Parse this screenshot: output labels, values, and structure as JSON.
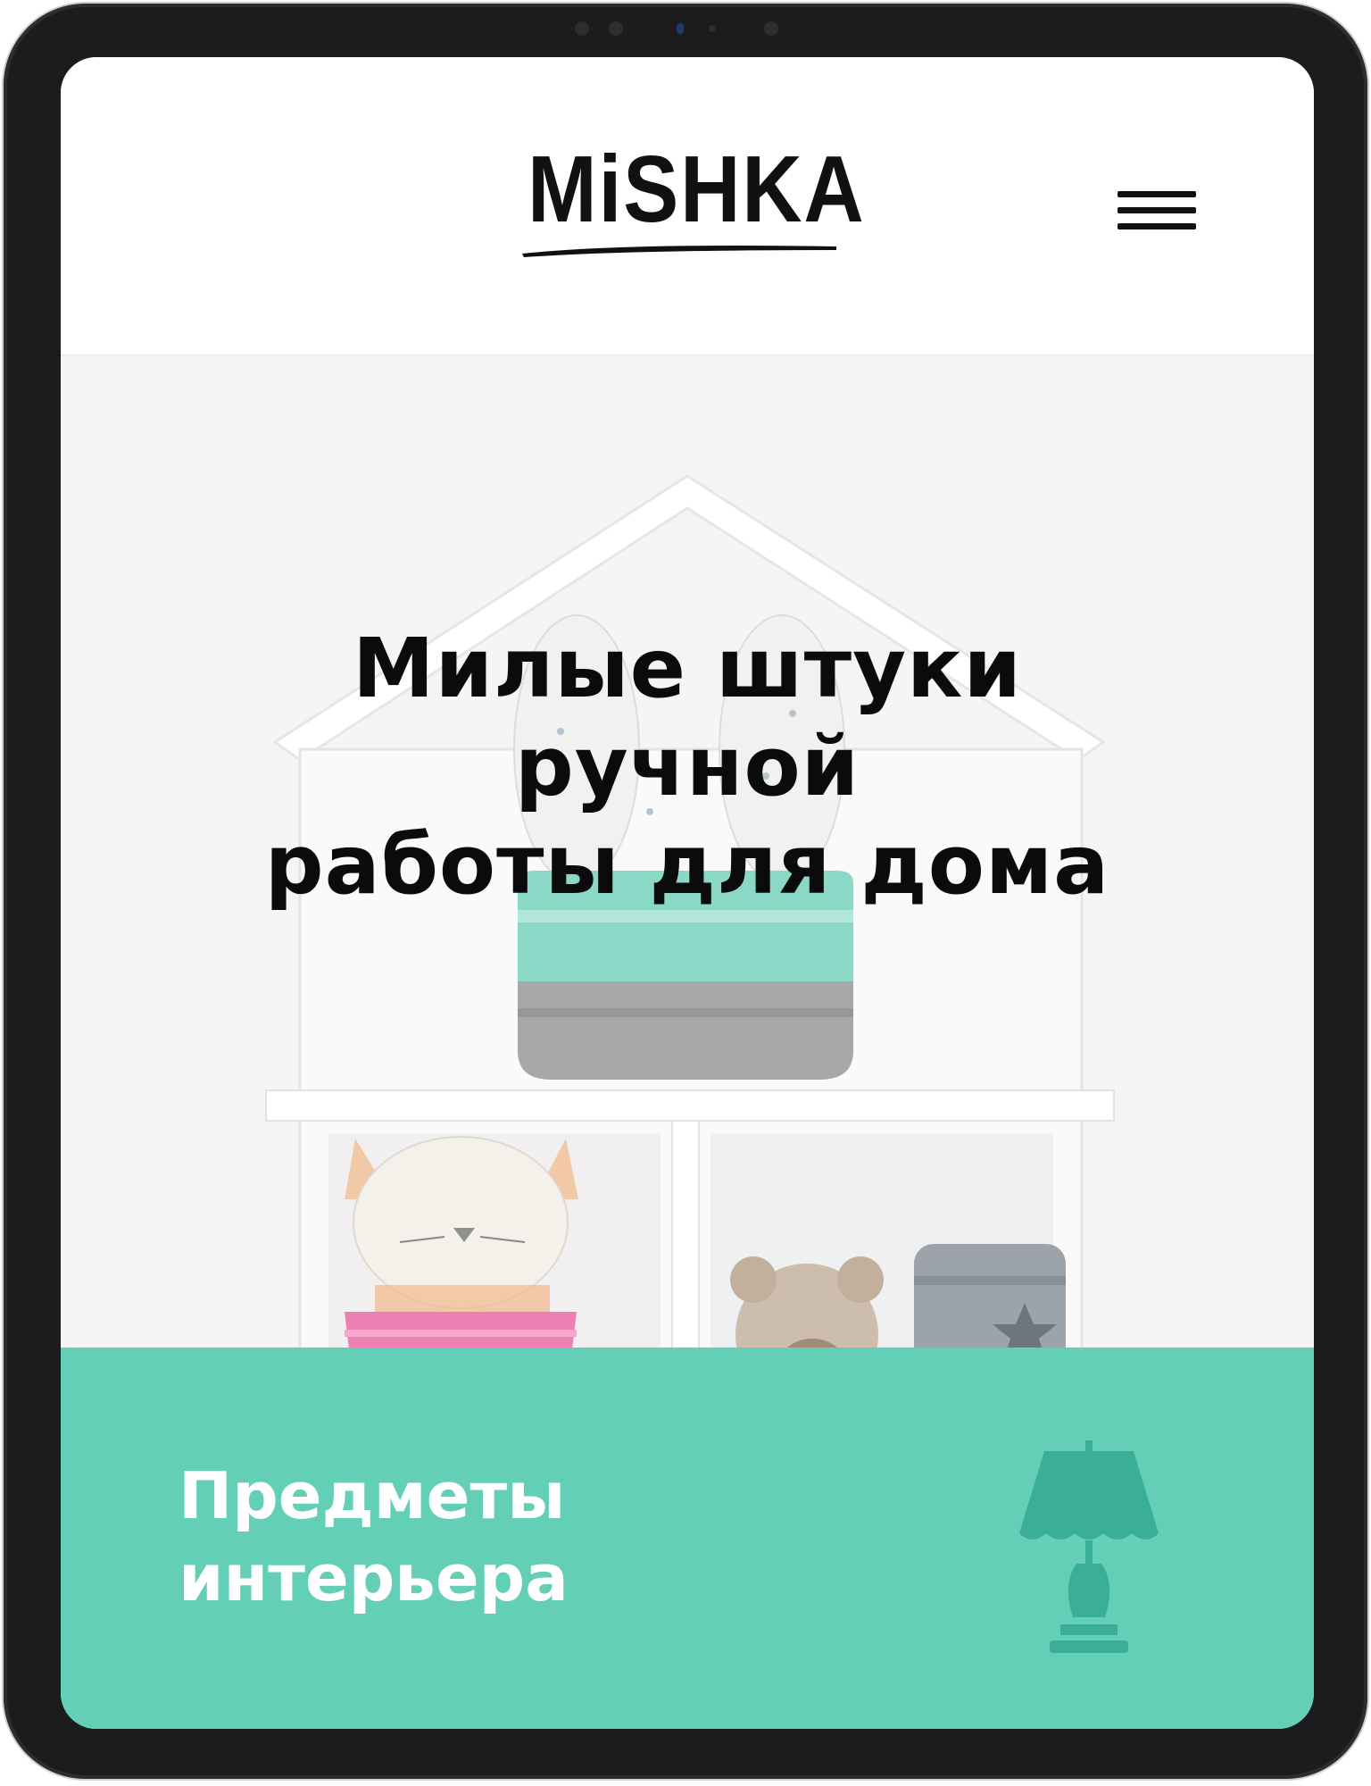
{
  "device": {
    "type": "tablet"
  },
  "header": {
    "logo_text": "MiSHKA",
    "menu_icon": "hamburger-menu-icon"
  },
  "hero": {
    "title": "Милые штуки\nручной\nработы для дома",
    "image_subject": "white house-shaped shelf with handmade toys"
  },
  "catalog": {
    "title": "Предметы\nинтерьера",
    "icon": "lamp-icon",
    "background_color": "#62cfb6"
  },
  "colors": {
    "accent": "#62cfb6",
    "lamp_icon": "#3aae98",
    "text_dark": "#0b0b0b",
    "text_light": "#ffffff"
  }
}
